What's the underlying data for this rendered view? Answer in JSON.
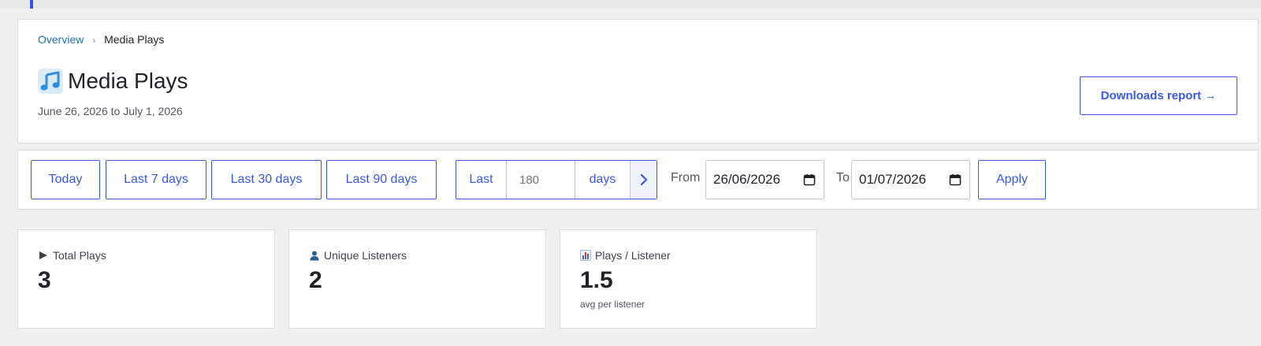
{
  "breadcrumb": {
    "overview": "Overview",
    "separator": "›",
    "current": "Media Plays"
  },
  "header": {
    "title": "Media Plays",
    "title_icon": "music-note-icon",
    "date_range": "June 26, 2026 to July 1, 2026",
    "downloads_label": "Downloads report →"
  },
  "filters": {
    "presets": [
      "Today",
      "Last 7 days",
      "Last 30 days",
      "Last 90 days"
    ],
    "custom": {
      "prefix": "Last",
      "placeholder": "180",
      "unit": "days"
    },
    "from_label": "From",
    "from_value": "26/06/2026",
    "to_label": "To",
    "to_value": "01/07/2026",
    "apply_label": "Apply"
  },
  "stats": [
    {
      "icon": "play-icon",
      "label": "Total Plays",
      "value": "3",
      "sub": ""
    },
    {
      "icon": "user-icon",
      "label": "Unique Listeners",
      "value": "2",
      "sub": ""
    },
    {
      "icon": "bar-chart-icon",
      "label": "Plays / Listener",
      "value": "1.5",
      "sub": "avg per listener"
    }
  ],
  "colors": {
    "accent": "#3858e9",
    "link": "#2271b1",
    "background": "#f0f0f1"
  }
}
